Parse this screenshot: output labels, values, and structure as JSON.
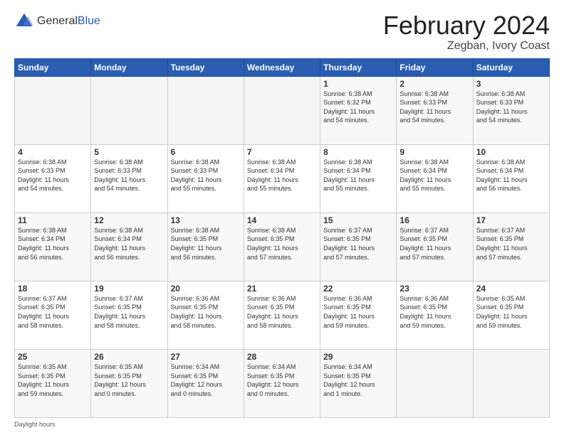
{
  "header": {
    "logo_general": "General",
    "logo_blue": "Blue",
    "month_title": "February 2024",
    "location": "Zegban, Ivory Coast"
  },
  "days_of_week": [
    "Sunday",
    "Monday",
    "Tuesday",
    "Wednesday",
    "Thursday",
    "Friday",
    "Saturday"
  ],
  "weeks": [
    [
      {
        "day": "",
        "info": ""
      },
      {
        "day": "",
        "info": ""
      },
      {
        "day": "",
        "info": ""
      },
      {
        "day": "",
        "info": ""
      },
      {
        "day": "1",
        "info": "Sunrise: 6:38 AM\nSunset: 6:32 PM\nDaylight: 11 hours\nand 54 minutes."
      },
      {
        "day": "2",
        "info": "Sunrise: 6:38 AM\nSunset: 6:33 PM\nDaylight: 11 hours\nand 54 minutes."
      },
      {
        "day": "3",
        "info": "Sunrise: 6:38 AM\nSunset: 6:33 PM\nDaylight: 11 hours\nand 54 minutes."
      }
    ],
    [
      {
        "day": "4",
        "info": "Sunrise: 6:38 AM\nSunset: 6:33 PM\nDaylight: 11 hours\nand 54 minutes."
      },
      {
        "day": "5",
        "info": "Sunrise: 6:38 AM\nSunset: 6:33 PM\nDaylight: 11 hours\nand 54 minutes."
      },
      {
        "day": "6",
        "info": "Sunrise: 6:38 AM\nSunset: 6:33 PM\nDaylight: 11 hours\nand 55 minutes."
      },
      {
        "day": "7",
        "info": "Sunrise: 6:38 AM\nSunset: 6:34 PM\nDaylight: 11 hours\nand 55 minutes."
      },
      {
        "day": "8",
        "info": "Sunrise: 6:38 AM\nSunset: 6:34 PM\nDaylight: 11 hours\nand 55 minutes."
      },
      {
        "day": "9",
        "info": "Sunrise: 6:38 AM\nSunset: 6:34 PM\nDaylight: 11 hours\nand 55 minutes."
      },
      {
        "day": "10",
        "info": "Sunrise: 6:38 AM\nSunset: 6:34 PM\nDaylight: 11 hours\nand 56 minutes."
      }
    ],
    [
      {
        "day": "11",
        "info": "Sunrise: 6:38 AM\nSunset: 6:34 PM\nDaylight: 11 hours\nand 56 minutes."
      },
      {
        "day": "12",
        "info": "Sunrise: 6:38 AM\nSunset: 6:34 PM\nDaylight: 11 hours\nand 56 minutes."
      },
      {
        "day": "13",
        "info": "Sunrise: 6:38 AM\nSunset: 6:35 PM\nDaylight: 11 hours\nand 56 minutes."
      },
      {
        "day": "14",
        "info": "Sunrise: 6:38 AM\nSunset: 6:35 PM\nDaylight: 11 hours\nand 57 minutes."
      },
      {
        "day": "15",
        "info": "Sunrise: 6:37 AM\nSunset: 6:35 PM\nDaylight: 11 hours\nand 57 minutes."
      },
      {
        "day": "16",
        "info": "Sunrise: 6:37 AM\nSunset: 6:35 PM\nDaylight: 11 hours\nand 57 minutes."
      },
      {
        "day": "17",
        "info": "Sunrise: 6:37 AM\nSunset: 6:35 PM\nDaylight: 11 hours\nand 57 minutes."
      }
    ],
    [
      {
        "day": "18",
        "info": "Sunrise: 6:37 AM\nSunset: 6:35 PM\nDaylight: 11 hours\nand 58 minutes."
      },
      {
        "day": "19",
        "info": "Sunrise: 6:37 AM\nSunset: 6:35 PM\nDaylight: 11 hours\nand 58 minutes."
      },
      {
        "day": "20",
        "info": "Sunrise: 6:36 AM\nSunset: 6:35 PM\nDaylight: 11 hours\nand 58 minutes."
      },
      {
        "day": "21",
        "info": "Sunrise: 6:36 AM\nSunset: 6:35 PM\nDaylight: 11 hours\nand 58 minutes."
      },
      {
        "day": "22",
        "info": "Sunrise: 6:36 AM\nSunset: 6:35 PM\nDaylight: 11 hours\nand 59 minutes."
      },
      {
        "day": "23",
        "info": "Sunrise: 6:36 AM\nSunset: 6:35 PM\nDaylight: 11 hours\nand 59 minutes."
      },
      {
        "day": "24",
        "info": "Sunrise: 6:35 AM\nSunset: 6:35 PM\nDaylight: 11 hours\nand 59 minutes."
      }
    ],
    [
      {
        "day": "25",
        "info": "Sunrise: 6:35 AM\nSunset: 6:35 PM\nDaylight: 11 hours\nand 59 minutes."
      },
      {
        "day": "26",
        "info": "Sunrise: 6:35 AM\nSunset: 6:35 PM\nDaylight: 12 hours\nand 0 minutes."
      },
      {
        "day": "27",
        "info": "Sunrise: 6:34 AM\nSunset: 6:35 PM\nDaylight: 12 hours\nand 0 minutes."
      },
      {
        "day": "28",
        "info": "Sunrise: 6:34 AM\nSunset: 6:35 PM\nDaylight: 12 hours\nand 0 minutes."
      },
      {
        "day": "29",
        "info": "Sunrise: 6:34 AM\nSunset: 6:35 PM\nDaylight: 12 hours\nand 1 minute."
      },
      {
        "day": "",
        "info": ""
      },
      {
        "day": "",
        "info": ""
      }
    ]
  ],
  "footer": {
    "label": "Daylight hours"
  }
}
